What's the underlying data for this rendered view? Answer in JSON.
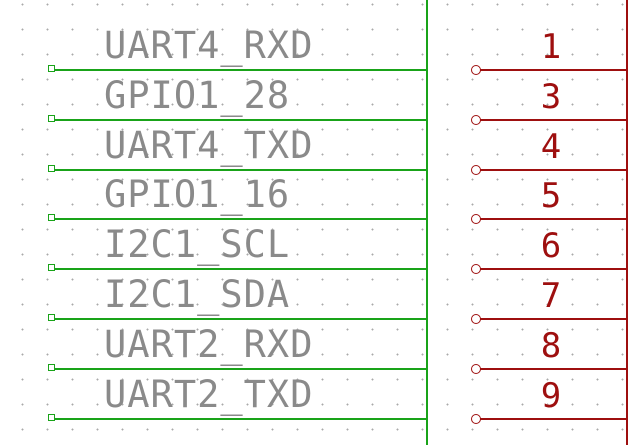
{
  "schematic": {
    "nets": [
      {
        "name": "UART4_RXD",
        "pin": "1"
      },
      {
        "name": "GPIO1_28",
        "pin": "3"
      },
      {
        "name": "UART4_TXD",
        "pin": "4"
      },
      {
        "name": "GPIO1_16",
        "pin": "5"
      },
      {
        "name": "I2C1_SCL",
        "pin": "6"
      },
      {
        "name": "I2C1_SDA",
        "pin": "7"
      },
      {
        "name": "UART2_RXD",
        "pin": "8"
      },
      {
        "name": "UART2_TXD",
        "pin": "9"
      }
    ],
    "colors": {
      "wire": "#19a319",
      "pin": "#9e0f0f",
      "net_label_text": "#8a8a8a",
      "grid_dot": "#a9a9a9"
    }
  }
}
